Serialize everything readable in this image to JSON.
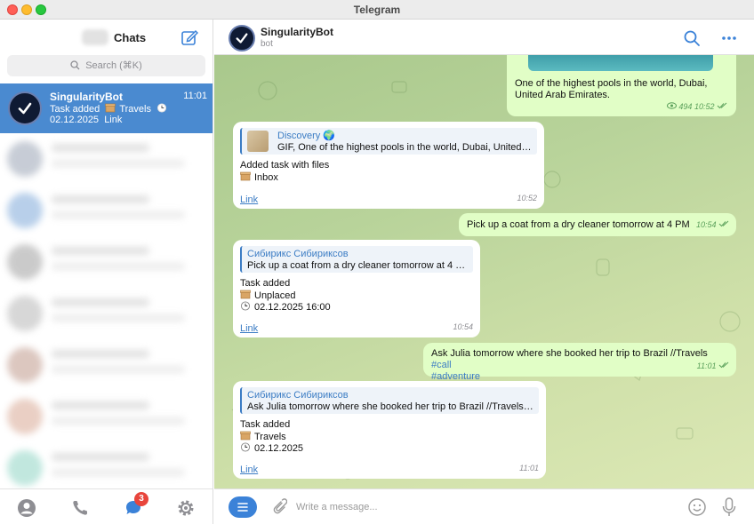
{
  "window": {
    "title": "Telegram"
  },
  "sidebar": {
    "title": "Chats",
    "search_placeholder": "Search (⌘K)",
    "active_chat": {
      "name": "SingularityBot",
      "time": "11:01",
      "preview_text": "Task added",
      "preview_category": "Travels",
      "preview_date": "02.12.2025",
      "preview_link": "Link"
    },
    "blurred_chat_colors": [
      "#9aa4b5",
      "#7fa9d9",
      "#a0a0a0",
      "#b7b7b7",
      "#c09a8c",
      "#d9a995",
      "#8fd4c4"
    ],
    "bottom_badge": "3"
  },
  "chat": {
    "name": "SingularityBot",
    "subtitle": "bot",
    "messages": {
      "m1": {
        "text": "One of the highest pools in the world, Dubai, United Arab Emirates.",
        "views": "494",
        "time": "10:52"
      },
      "m2": {
        "quote_name": "Discovery 🌍",
        "quote_text": "GIF, One of the highest pools in the world, Dubai, United Ar...",
        "line1": "Added task with files",
        "line2": "Inbox",
        "link": "Link",
        "time": "10:52"
      },
      "m3": {
        "text": "Pick up a coat from a dry cleaner tomorrow at 4 PM",
        "time": "10:54"
      },
      "m4": {
        "quote_name": "Сибирикс Сибириксов",
        "quote_text": "Pick up a coat from a dry cleaner tomorrow at 4 PM",
        "line1": "Task added",
        "line2": "Unplaced",
        "line3": "02.12.2025 16:00",
        "link": "Link",
        "time": "10:54"
      },
      "m5": {
        "text": "Ask Julia tomorrow where she booked her trip to Brazil //Travels",
        "tag1": "#call",
        "tag2": "#adventure",
        "time": "11:01"
      },
      "m6": {
        "quote_name": "Сибирикс Сибириксов",
        "quote_text": "Ask Julia tomorrow where she booked her trip to Brazil //Travels #...",
        "line1": "Task added",
        "line2": "Travels",
        "line3": "02.12.2025",
        "link": "Link",
        "time": "11:01"
      }
    },
    "input_placeholder": "Write a message..."
  },
  "colors": {
    "accent": "#3b82d8",
    "selected_chat": "#4a8ad0",
    "outgoing_bubble": "#e1fec6",
    "badge": "#e8453c"
  }
}
